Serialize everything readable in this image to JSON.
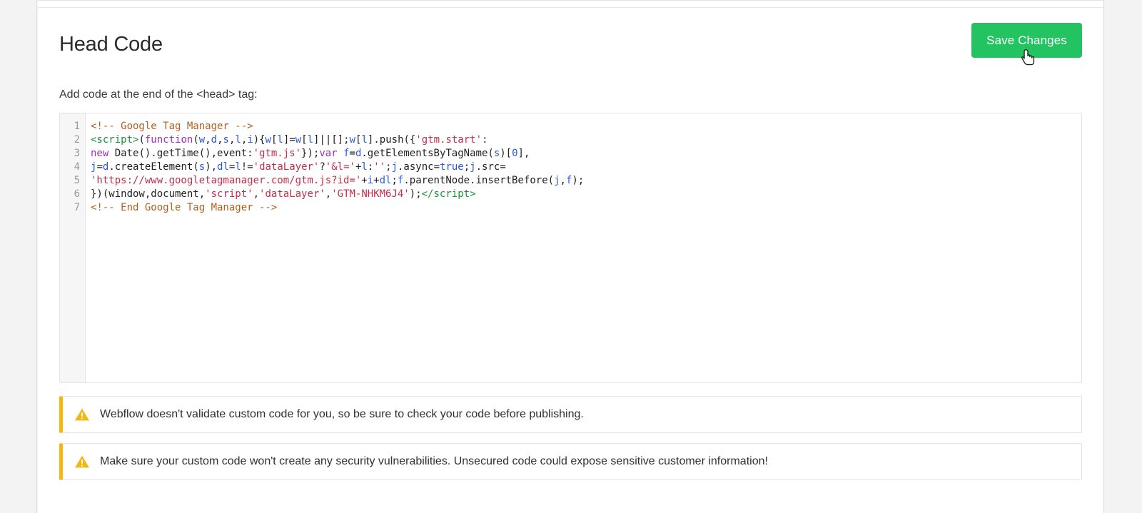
{
  "page": {
    "title": "Head Code",
    "instruction": "Add code at the end of the <head> tag:"
  },
  "toolbar": {
    "save_label": "Save Changes",
    "save_color": "#24c362",
    "cursor": "pointer-hand-cursor"
  },
  "editor": {
    "line_numbers": [
      "1",
      "2",
      "3",
      "4",
      "5",
      "6",
      "7"
    ],
    "raw_code": "<!-- Google Tag Manager -->\n<script>(function(w,d,s,l,i){w[l]=w[l]||[];w[l].push({'gtm.start':\nnew Date().getTime(),event:'gtm.js'});var f=d.getElementsByTagName(s)[0],\nj=d.createElement(s),dl=l!='dataLayer'?'&l='+l:'';j.async=true;j.src=\n'https://www.googletagmanager.com/gtm.js?id='+i+dl;f.parentNode.insertBefore(j,f);\n})(window,document,'script','dataLayer','GTM-NHKM6J4');</script>\n<!-- End Google Tag Manager -->",
    "gtm_container_id": "GTM-NHKM6J4",
    "lines": [
      {
        "num": "1",
        "tokens": [
          {
            "t": "<!-- Google Tag Manager -->",
            "c": "tok-comment"
          }
        ]
      },
      {
        "num": "2",
        "tokens": [
          {
            "t": "<script>",
            "c": "tok-tag"
          },
          {
            "t": "(",
            "c": "tok-plain"
          },
          {
            "t": "function",
            "c": "tok-kw"
          },
          {
            "t": "(",
            "c": "tok-plain"
          },
          {
            "t": "w",
            "c": "tok-var"
          },
          {
            "t": ",",
            "c": "tok-plain"
          },
          {
            "t": "d",
            "c": "tok-var"
          },
          {
            "t": ",",
            "c": "tok-plain"
          },
          {
            "t": "s",
            "c": "tok-var"
          },
          {
            "t": ",",
            "c": "tok-plain"
          },
          {
            "t": "l",
            "c": "tok-var"
          },
          {
            "t": ",",
            "c": "tok-plain"
          },
          {
            "t": "i",
            "c": "tok-var"
          },
          {
            "t": "){",
            "c": "tok-plain"
          },
          {
            "t": "w",
            "c": "tok-var"
          },
          {
            "t": "[",
            "c": "tok-plain"
          },
          {
            "t": "l",
            "c": "tok-var"
          },
          {
            "t": "]=",
            "c": "tok-plain"
          },
          {
            "t": "w",
            "c": "tok-var"
          },
          {
            "t": "[",
            "c": "tok-plain"
          },
          {
            "t": "l",
            "c": "tok-var"
          },
          {
            "t": "]||[];",
            "c": "tok-plain"
          },
          {
            "t": "w",
            "c": "tok-var"
          },
          {
            "t": "[",
            "c": "tok-plain"
          },
          {
            "t": "l",
            "c": "tok-var"
          },
          {
            "t": "].push({",
            "c": "tok-plain"
          },
          {
            "t": "'gtm.start'",
            "c": "tok-str"
          },
          {
            "t": ":",
            "c": "tok-plain"
          }
        ]
      },
      {
        "num": "3",
        "tokens": [
          {
            "t": "new",
            "c": "tok-kw"
          },
          {
            "t": " Date().getTime(),event:",
            "c": "tok-plain"
          },
          {
            "t": "'gtm.js'",
            "c": "tok-str"
          },
          {
            "t": "});",
            "c": "tok-plain"
          },
          {
            "t": "var",
            "c": "tok-kw"
          },
          {
            "t": " ",
            "c": "tok-plain"
          },
          {
            "t": "f",
            "c": "tok-var"
          },
          {
            "t": "=",
            "c": "tok-plain"
          },
          {
            "t": "d",
            "c": "tok-var"
          },
          {
            "t": ".getElementsByTagName(",
            "c": "tok-plain"
          },
          {
            "t": "s",
            "c": "tok-var"
          },
          {
            "t": ")[",
            "c": "tok-plain"
          },
          {
            "t": "0",
            "c": "tok-num"
          },
          {
            "t": "],",
            "c": "tok-plain"
          }
        ]
      },
      {
        "num": "4",
        "tokens": [
          {
            "t": "j",
            "c": "tok-var"
          },
          {
            "t": "=",
            "c": "tok-plain"
          },
          {
            "t": "d",
            "c": "tok-var"
          },
          {
            "t": ".createElement(",
            "c": "tok-plain"
          },
          {
            "t": "s",
            "c": "tok-var"
          },
          {
            "t": "),",
            "c": "tok-plain"
          },
          {
            "t": "dl",
            "c": "tok-var"
          },
          {
            "t": "=",
            "c": "tok-plain"
          },
          {
            "t": "l",
            "c": "tok-var"
          },
          {
            "t": "!=",
            "c": "tok-plain"
          },
          {
            "t": "'dataLayer'",
            "c": "tok-str"
          },
          {
            "t": "?",
            "c": "tok-plain"
          },
          {
            "t": "'&l='",
            "c": "tok-str"
          },
          {
            "t": "+",
            "c": "tok-plain"
          },
          {
            "t": "l",
            "c": "tok-var"
          },
          {
            "t": ":",
            "c": "tok-plain"
          },
          {
            "t": "''",
            "c": "tok-str"
          },
          {
            "t": ";",
            "c": "tok-plain"
          },
          {
            "t": "j",
            "c": "tok-var"
          },
          {
            "t": ".async=",
            "c": "tok-plain"
          },
          {
            "t": "true",
            "c": "tok-var"
          },
          {
            "t": ";",
            "c": "tok-plain"
          },
          {
            "t": "j",
            "c": "tok-var"
          },
          {
            "t": ".src=",
            "c": "tok-plain"
          }
        ]
      },
      {
        "num": "5",
        "tokens": [
          {
            "t": "'https://www.googletagmanager.com/gtm.js?id='",
            "c": "tok-str"
          },
          {
            "t": "+",
            "c": "tok-plain"
          },
          {
            "t": "i",
            "c": "tok-var"
          },
          {
            "t": "+",
            "c": "tok-plain"
          },
          {
            "t": "dl",
            "c": "tok-var"
          },
          {
            "t": ";",
            "c": "tok-plain"
          },
          {
            "t": "f",
            "c": "tok-var"
          },
          {
            "t": ".parentNode.insertBefore(",
            "c": "tok-plain"
          },
          {
            "t": "j",
            "c": "tok-var"
          },
          {
            "t": ",",
            "c": "tok-plain"
          },
          {
            "t": "f",
            "c": "tok-var"
          },
          {
            "t": ");",
            "c": "tok-plain"
          }
        ]
      },
      {
        "num": "6",
        "tokens": [
          {
            "t": "})(window,document,",
            "c": "tok-plain"
          },
          {
            "t": "'script'",
            "c": "tok-str"
          },
          {
            "t": ",",
            "c": "tok-plain"
          },
          {
            "t": "'dataLayer'",
            "c": "tok-str"
          },
          {
            "t": ",",
            "c": "tok-plain"
          },
          {
            "t": "'GTM-NHKM6J4'",
            "c": "tok-str"
          },
          {
            "t": ");",
            "c": "tok-plain"
          },
          {
            "t": "</script",
            "c": "tok-tag"
          },
          {
            "t": ">",
            "c": "tok-tag"
          }
        ]
      },
      {
        "num": "7",
        "tokens": [
          {
            "t": "<!-- End Google Tag Manager -->",
            "c": "tok-comment"
          }
        ]
      }
    ]
  },
  "warnings": [
    {
      "icon": "warning-triangle-icon",
      "text": "Webflow doesn't validate custom code for you, so be sure to check your code before publishing.",
      "accent": "#f2b717"
    },
    {
      "icon": "warning-triangle-icon",
      "text": "Make sure your custom code won't create any security vulnerabilities. Unsecured code could expose sensitive customer information!",
      "accent": "#f2b717"
    }
  ]
}
